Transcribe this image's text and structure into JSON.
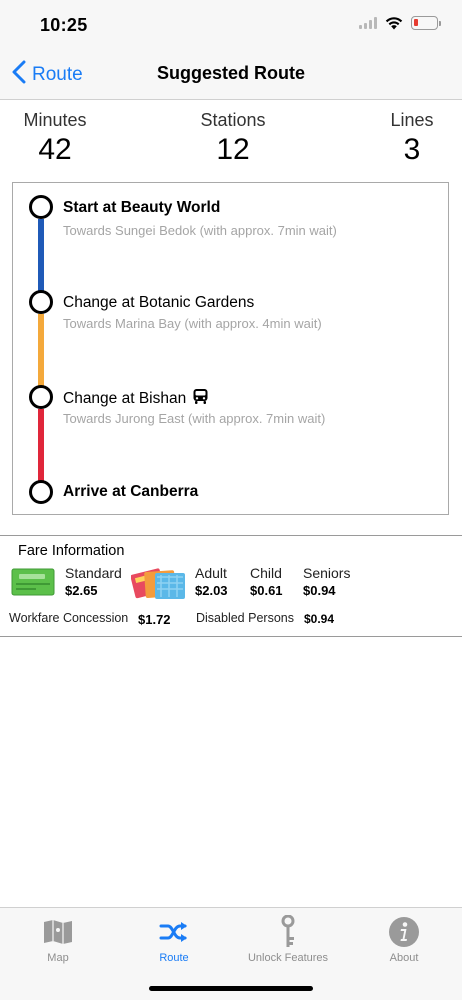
{
  "status": {
    "time": "10:25"
  },
  "nav": {
    "back_label": "Route",
    "title": "Suggested Route"
  },
  "stats": {
    "minutes_label": "Minutes",
    "minutes_value": "42",
    "stations_label": "Stations",
    "stations_value": "12",
    "lines_label": "Lines",
    "lines_value": "3"
  },
  "route": {
    "stops": [
      {
        "title": "Start at Beauty World",
        "subtitle": "Towards Sungei Bedok (with approx. 7min wait)"
      },
      {
        "title": "Change at Botanic Gardens",
        "subtitle": "Towards Marina Bay (with approx. 4min wait)"
      },
      {
        "title": "Change at Bishan",
        "subtitle": "Towards Jurong East (with approx. 7min wait)"
      },
      {
        "title": "Arrive at Canberra",
        "subtitle": ""
      }
    ],
    "line_colors": [
      "#1f5ab8",
      "#f4a93b",
      "#e0263a"
    ]
  },
  "fare": {
    "title": "Fare Information",
    "standard_label": "Standard",
    "standard_value": "$2.65",
    "adult_label": "Adult",
    "adult_value": "$2.03",
    "child_label": "Child",
    "child_value": "$0.61",
    "seniors_label": "Seniors",
    "seniors_value": "$0.94",
    "workfare_label": "Workfare Concession",
    "workfare_value": "$1.72",
    "disabled_label": "Disabled Persons",
    "disabled_value": "$0.94"
  },
  "tabs": [
    {
      "label": "Map",
      "icon": "map-icon"
    },
    {
      "label": "Route",
      "icon": "shuffle-icon",
      "active": true
    },
    {
      "label": "Unlock Features",
      "icon": "key-icon"
    },
    {
      "label": "About",
      "icon": "info-icon"
    }
  ],
  "colors": {
    "accent": "#1a7cf5"
  }
}
